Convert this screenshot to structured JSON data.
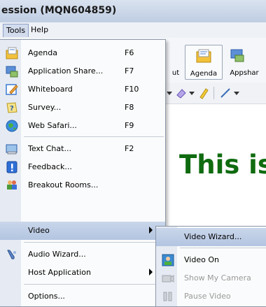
{
  "window": {
    "title": "ession (MQN604859)"
  },
  "menubar": {
    "items": [
      {
        "label": "Tools"
      },
      {
        "label": "Help"
      }
    ]
  },
  "toolbar": {
    "partial_label": "ut",
    "agenda_label": "Agenda",
    "appshare_label": "Appshar"
  },
  "canvas": {
    "text": "This is"
  },
  "tools_menu": {
    "items": [
      {
        "label": "Agenda",
        "shortcut": "F6",
        "icon": "agenda-icon"
      },
      {
        "label": "Application Share...",
        "shortcut": "F7",
        "icon": "application-share-icon"
      },
      {
        "label": "Whiteboard",
        "shortcut": "F10",
        "icon": "whiteboard-icon"
      },
      {
        "label": "Survey...",
        "shortcut": "F8",
        "icon": "survey-icon"
      },
      {
        "label": "Web Safari...",
        "shortcut": "F9",
        "icon": "web-safari-icon"
      },
      {
        "label": "Text Chat...",
        "shortcut": "F2",
        "icon": "text-chat-icon"
      },
      {
        "label": "Feedback...",
        "shortcut": "",
        "icon": "feedback-icon"
      },
      {
        "label": "Breakout Rooms...",
        "shortcut": "",
        "icon": "breakout-rooms-icon"
      },
      {
        "label": "Video",
        "shortcut": "",
        "icon": "",
        "submenu": true
      },
      {
        "label": "Audio Wizard...",
        "shortcut": "",
        "icon": "audio-wizard-icon"
      },
      {
        "label": "Host Application",
        "shortcut": "",
        "icon": "",
        "submenu": true
      },
      {
        "label": "Options...",
        "shortcut": "",
        "icon": ""
      }
    ]
  },
  "video_submenu": {
    "items": [
      {
        "label": "Video Wizard...",
        "icon": ""
      },
      {
        "label": "Video On",
        "icon": "video-on-icon"
      },
      {
        "label": "Show My Camera",
        "icon": "camera-icon",
        "disabled": true
      },
      {
        "label": "Pause Video",
        "icon": "pause-video-icon",
        "disabled": true
      }
    ]
  }
}
